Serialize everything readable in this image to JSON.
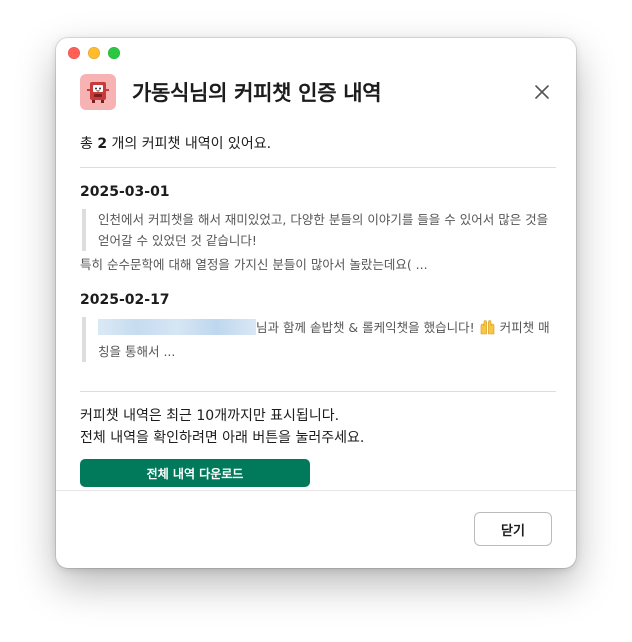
{
  "window": {
    "title": "가동식님의 커피챗 인증 내역"
  },
  "summary": {
    "prefix": "총 ",
    "count": "2",
    "suffix": " 개의 커피챗 내역이 있어요."
  },
  "entries": [
    {
      "date": "2025-03-01",
      "quote": "인천에서 커피챗을 해서 재미있었고, 다양한 분들의 이야기를 들을 수 있어서 많은 것을 얻어갈 수 있었던 것 같습니다!",
      "extra": "특히 순수문학에 대해 열정을 가지신 분들이 많아서 놀랐는데요( ..."
    },
    {
      "date": "2025-02-17",
      "quote_after_redaction": "님과 함께 솥밥챗 & 롤케익챗을 했습니다!",
      "quote_tail": "커피챗 매칭을 통해서 ..."
    }
  ],
  "footer": {
    "note_line1": "커피챗 내역은 최근 10개까지만 표시됩니다.",
    "note_line2": "전체 내역을 확인하려면 아래 버튼을 눌러주세요.",
    "download_label": "전체 내역 다운로드",
    "close_label": "닫기"
  },
  "colors": {
    "accent": "#007a5a",
    "app_icon_bg": "#f7b3b3",
    "quote_bar": "#dddddd"
  },
  "icons": {
    "app": "coffee-chat-app-icon",
    "close": "close-icon",
    "hands": "raised-hands-emoji"
  }
}
